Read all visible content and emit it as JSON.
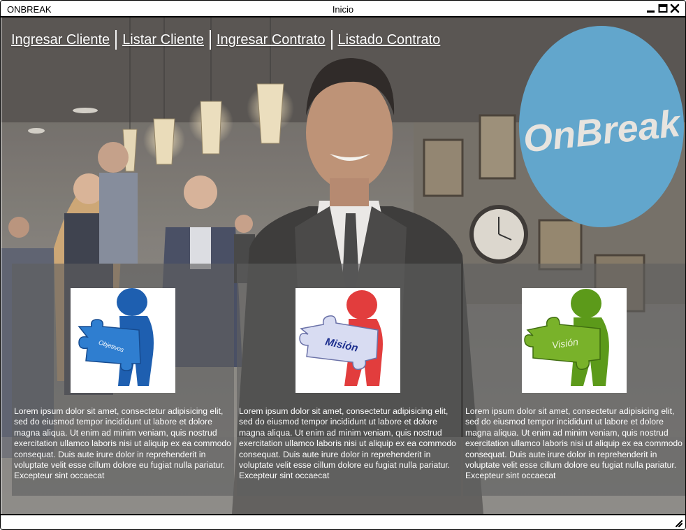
{
  "window": {
    "app_name": "ONBREAK",
    "title": "Inicio",
    "controls": [
      "minimize-icon",
      "maximize-icon",
      "close-icon"
    ]
  },
  "nav": {
    "items": [
      {
        "label": "Ingresar Cliente"
      },
      {
        "label": "Listar Cliente"
      },
      {
        "label": "Ingresar Contrato"
      },
      {
        "label": "Listado Contrato"
      }
    ]
  },
  "logo": {
    "text": "OnBreak",
    "color": "#62a6cc"
  },
  "panels": [
    {
      "image_label": "Objetivos",
      "figure_color": "#1e5fb0",
      "puzzle_color": "#2f7ed0",
      "text": "Lorem ipsum dolor sit amet, consectetur adipisicing elit, sed do eiusmod tempor incididunt ut labore et dolore magna aliqua. Ut enim ad minim veniam, quis nostrud exercitation ullamco laboris nisi ut aliquip ex ea commodo consequat. Duis aute irure dolor in reprehenderit in voluptate velit esse cillum dolore eu fugiat nulla pariatur. Excepteur sint occaecat"
    },
    {
      "image_label": "Misión",
      "figure_color": "#e23d3d",
      "puzzle_color": "#d8dcf2",
      "text": "Lorem ipsum dolor sit amet, consectetur adipisicing elit, sed do eiusmod tempor incididunt ut labore et dolore magna aliqua. Ut enim ad minim veniam, quis nostrud exercitation ullamco laboris nisi ut aliquip ex ea commodo consequat. Duis aute irure dolor in reprehenderit in voluptate velit esse cillum dolore eu fugiat nulla pariatur. Excepteur sint occaecat"
    },
    {
      "image_label": "Visión",
      "figure_color": "#5c9a1a",
      "puzzle_color": "#79b22a",
      "text": "Lorem ipsum dolor sit amet, consectetur adipisicing elit, sed do eiusmod tempor incididunt ut labore et dolore magna aliqua. Ut enim ad minim veniam, quis nostrud exercitation ullamco laboris nisi ut aliquip ex ea commodo consequat. Duis aute irure dolor in reprehenderit in voluptate velit esse cillum dolore eu fugiat nulla pariatur. Excepteur sint occaecat"
    }
  ]
}
